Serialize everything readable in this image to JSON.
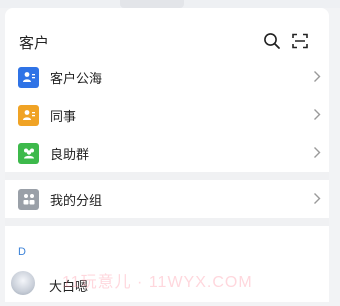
{
  "header": {
    "title": "客户",
    "search_icon": "search-icon",
    "scan_icon": "scan-icon"
  },
  "menu": [
    {
      "label": "客户公海",
      "icon": "customer-pool-icon",
      "color": "#2f73e6"
    },
    {
      "label": "同事",
      "icon": "colleague-icon",
      "color": "#f0a325"
    },
    {
      "label": "良助群",
      "icon": "group-icon",
      "color": "#3db94b"
    }
  ],
  "groups": {
    "label": "我的分组",
    "icon": "groups-icon",
    "color": "#9aa0a8"
  },
  "section": {
    "letter": "D"
  },
  "contacts": [
    {
      "name": "大白嗯",
      "avatar": "avatar"
    }
  ],
  "watermark": "11玩意儿 · 11WYX.COM"
}
